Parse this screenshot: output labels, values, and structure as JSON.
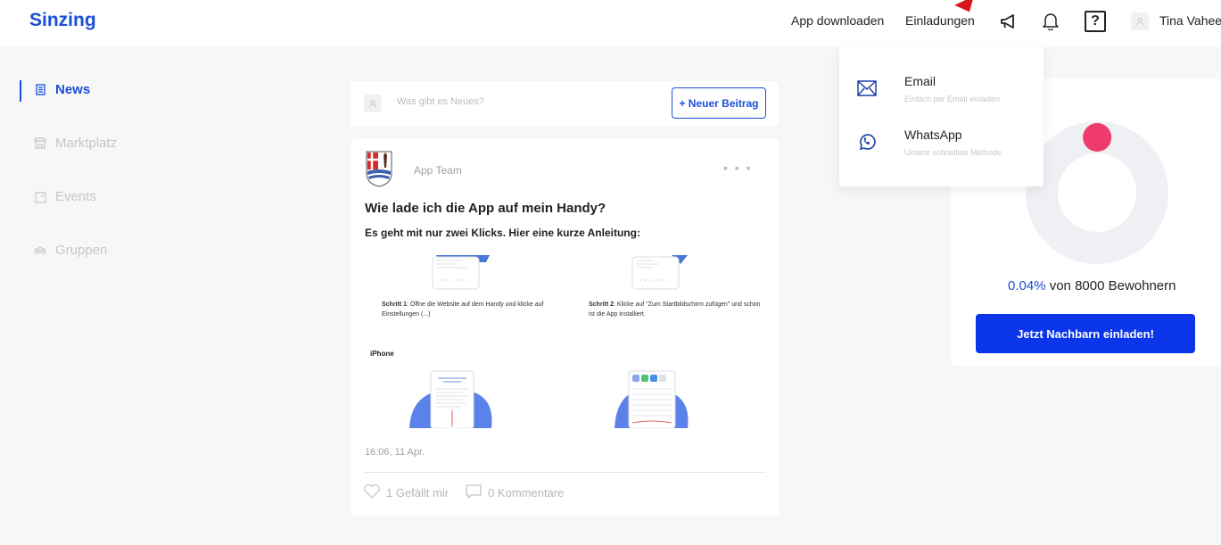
{
  "header": {
    "brand": "Sinzing",
    "app_download": "App downloaden",
    "invitations": "Einladungen",
    "help_glyph": "?",
    "user_name": "Tina Vahee",
    "icons": [
      "megaphone-icon",
      "bell-icon",
      "help-icon",
      "user-avatar-icon"
    ]
  },
  "sidebar": {
    "items": [
      {
        "label": "News",
        "icon": "news-icon",
        "active": true
      },
      {
        "label": "Marktplatz",
        "icon": "store-icon",
        "active": false
      },
      {
        "label": "Events",
        "icon": "calendar-icon",
        "active": false
      },
      {
        "label": "Gruppen",
        "icon": "group-icon",
        "active": false
      }
    ]
  },
  "composer": {
    "placeholder": "Was gibt es Neues?",
    "new_post_label": "+ Neuer Beitrag"
  },
  "post": {
    "author": "App Team",
    "more": "• • •",
    "title": "Wie lade ich die App auf mein Handy?",
    "subtitle": "Es geht mit nur zwei Klicks. Hier eine kurze Anleitung:",
    "step1_label": "Schritt 1",
    "step1_text": ": Öffne die Website auf dem Handy und klicke auf Einstellungen (...)",
    "step2_label": "Schritt 2",
    "step2_text": ": Klicke auf \"Zum Startbildschirm zufügen\" und schon ist die App installiert.",
    "iphone_label": "iPhone",
    "timestamp": "16:06, 11 Apr.",
    "likes": "1 Gefällt mir",
    "comments": "0 Kommentare"
  },
  "stats": {
    "percent": "0.04%",
    "suffix": " von 8000 Bewohnern",
    "progress_fraction": 0.0004,
    "invite_button": "Jetzt Nachbarn einladen!",
    "accent_color": "#ee3a6c",
    "track_color": "#eef0f3"
  },
  "dropdown": {
    "items": [
      {
        "title": "Email",
        "desc": "Einfach per Email einladen",
        "icon": "email-icon"
      },
      {
        "title": "WhatsApp",
        "desc": "Unsere schnellste Methode",
        "icon": "whatsapp-icon"
      }
    ]
  },
  "colors": {
    "brand": "#1a4fd6",
    "button": "#0a35e8",
    "marker": "#d9161c"
  }
}
